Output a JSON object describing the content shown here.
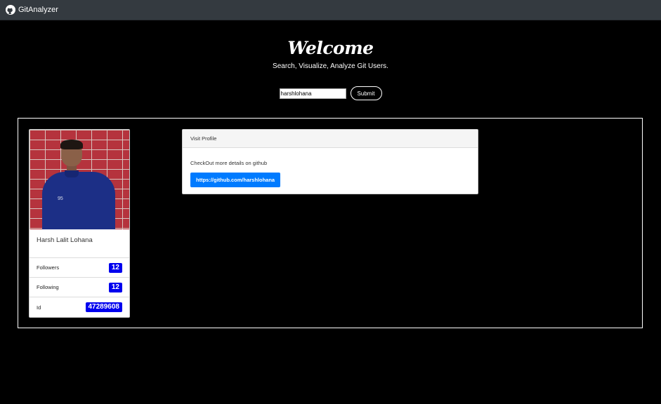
{
  "navbar": {
    "brand_label": "GitAnalyzer",
    "brand_icon": "github-icon"
  },
  "hero": {
    "title": "Welcome",
    "subtitle": "Search, Visualize, Analyze Git Users."
  },
  "search": {
    "value": "harshlohana",
    "submit_label": "Submit"
  },
  "profile": {
    "avatar": "user-photo",
    "name": "Harsh Lalit Lohana",
    "stats": [
      {
        "label": "Followers",
        "value": "12"
      },
      {
        "label": "Following",
        "value": "12"
      },
      {
        "label": "Id",
        "value": "47289608"
      }
    ]
  },
  "visit": {
    "header": "Visit Profile",
    "text": "CheckOut more details on github",
    "link_label": "https://github.com/harshlohana"
  },
  "colors": {
    "background": "#000000",
    "navbar": "#343a40",
    "badge": "#0000ee",
    "link_button": "#007bff"
  }
}
